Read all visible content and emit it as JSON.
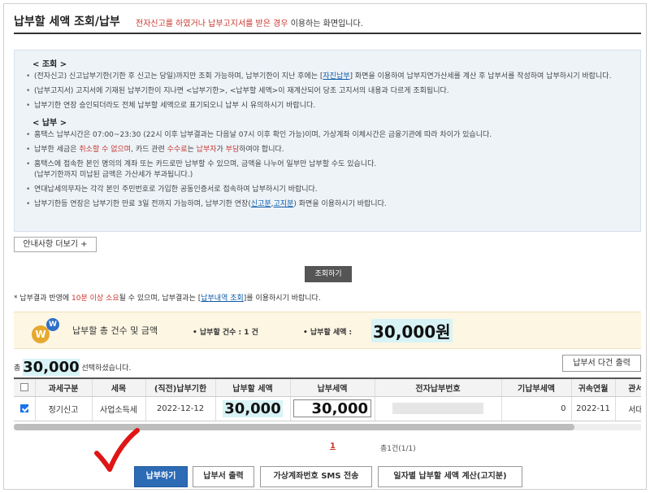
{
  "header": {
    "title": "납부할 세액 조회/납부",
    "subtitle_red": "전자신고를 하였거나 납부고지서를 받은 경우",
    "subtitle_rest": " 이용하는 화면입니다."
  },
  "guide": {
    "inquiry_heading": "< 조회 >",
    "inquiry_items": [
      {
        "pre": "(전자신고) 신고납부기한(기한 후 신고는 당일)까지만 조회 가능하며, 납부기한이 지난 후에는 [",
        "link": "자진납부",
        "post": "] 화면을 이용하여 납부지연가산세를 계산 후 납부서를 작성하여 납부하시기 바랍니다."
      },
      {
        "text": "(납부고지서) 고지서에 기재된 납부기한이 지나면 <납부기한>, <납부할 세액>이 재계산되어 당초 고지서의 내용과 다르게 조회됩니다."
      },
      {
        "text": "납부기한 연장 승인되더라도 전체 납부할 세액으로 표기되오니 납부 시 유의하시기 바랍니다."
      }
    ],
    "payment_heading": "< 납부 >",
    "payment_items": [
      {
        "text": "홈택스 납부시간은 07:00~23:30 (22시 이후 납부결과는 다음날 07시 이후 확인 가능)이며, 가상계좌 이체시간은 금융기관에 따라 차이가 있습니다."
      },
      {
        "pre": "납부한 세금은 ",
        "red1": "취소할 수 없으며",
        "mid": ", 카드 관련 ",
        "red2": "수수료",
        "mid2": "는 ",
        "red3": "납부자",
        "mid3": "가 ",
        "red4": "부담",
        "post": "하여야 합니다."
      },
      {
        "text": "홈택스에 접속한 본인 명의의 계좌 또는 카드로만 납부할 수 있으며, 금액을 나누어 일부만 납부할 수도 있습니다.",
        "text2": "(납부기한까지 미납된 금액은 가산세가 부과됩니다.)"
      },
      {
        "text": "연대납세의무자는 각각 본인 주민번호로 가입한 공동인증서로 접속하여 납부하시기 바랍니다."
      },
      {
        "pre": "납부기한등 연장은 납부기한 만료 3일 전까지 가능하며, 납부기한 연장(",
        "link1": "신고분",
        "mid": ",",
        "link2": "고지분",
        "post": ") 화면을 이용하시기 바랍니다."
      }
    ]
  },
  "buttons": {
    "more": "안내사항 더보기 +",
    "inquiry": "조회하기",
    "multi_print": "납부서 다건 출력",
    "pay": "납부하기",
    "print": "납부서 출력",
    "sms": "가상계좌번호 SMS 전송",
    "daily_calc": "일자별 납부할 세액 계산(고지분)"
  },
  "notice": {
    "pre": "* 납부결과 반영에 ",
    "red": "10분 이상 소요",
    "mid": "될 수 있으며, 납부결과는 [",
    "link": "납부내역 조회",
    "post": "]를 이용하시기 바랍니다."
  },
  "summary": {
    "coin_w1": "W",
    "coin_w2": "W",
    "label": "납부할 총 건수 및 금액",
    "count_label": "• 납부할 건수 : 1 건",
    "amount_label": "• 납부할 세액 :",
    "amount": "30,000원"
  },
  "selection": {
    "prefix": "총 ",
    "amount": "30,000",
    "suffix": " 선택하셨습니다."
  },
  "table": {
    "headers": [
      "과세구분",
      "세목",
      "(직전)납부기한",
      "납부할 세액",
      "납부세액",
      "전자납부번호",
      "기납부세액",
      "귀속연월",
      "관서명"
    ],
    "rows": [
      {
        "checked": true,
        "tax_class": "정기신고",
        "tax_item": "사업소득세",
        "due_date": "2022-12-12",
        "amount_due": "30,000",
        "pay_amount": "30,000",
        "prepaid": "0",
        "period": "2022-11",
        "office": "서대전"
      }
    ]
  },
  "pagination": {
    "current": "1",
    "info": "총1건(1/1)"
  }
}
